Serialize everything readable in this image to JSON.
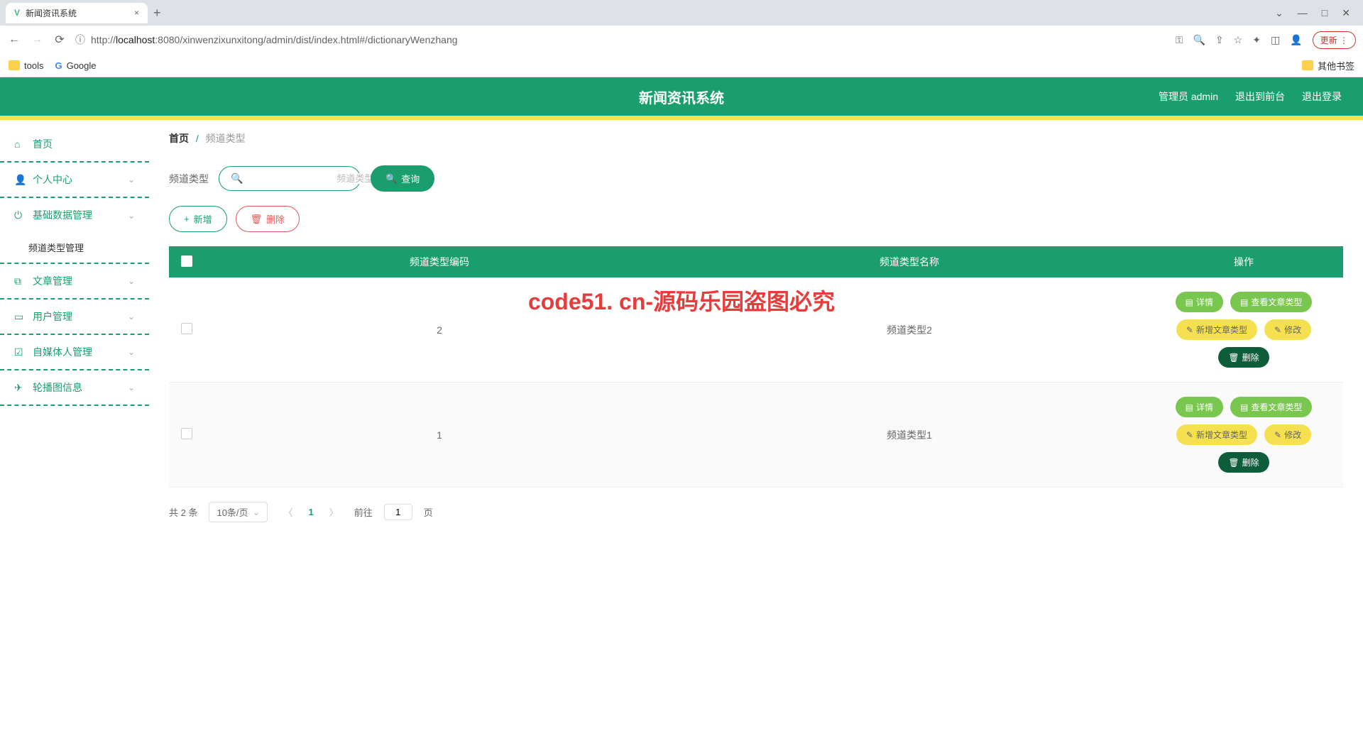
{
  "browser": {
    "tab_title": "新闻资讯系统",
    "url_info_icon": "ⓘ",
    "url_proto": "http://",
    "url_host": "localhost",
    "url_port": ":8080",
    "url_path": "/xinwenzixunxitong/admin/dist/index.html#/dictionaryWenzhang",
    "update_label": "更新",
    "bookmarks": {
      "tools": "tools",
      "google": "Google",
      "other": "其他书签"
    }
  },
  "header": {
    "title": "新闻资讯系统",
    "user": "管理员 admin",
    "to_front": "退出到前台",
    "logout": "退出登录"
  },
  "sidebar": {
    "home": "首页",
    "personal": "个人中心",
    "base_data": "基础数据管理",
    "channel_type_mgmt": "频道类型管理",
    "article": "文章管理",
    "user": "用户管理",
    "media": "自媒体人管理",
    "carousel": "轮播图信息"
  },
  "breadcrumb": {
    "home": "首页",
    "current": "频道类型"
  },
  "search": {
    "label": "频道类型",
    "placeholder": "频道类型",
    "btn": "查询"
  },
  "actions": {
    "add": "新增",
    "delete": "删除"
  },
  "table": {
    "col_code": "频道类型编码",
    "col_name": "频道类型名称",
    "col_op": "操作",
    "rows": [
      {
        "code": "2",
        "name": "频道类型2"
      },
      {
        "code": "1",
        "name": "频道类型1"
      }
    ],
    "ops": {
      "detail": "详情",
      "view_article": "查看文章类型",
      "add_article": "新增文章类型",
      "edit": "修改",
      "delete": "删除"
    }
  },
  "pager": {
    "total": "共 2 条",
    "size": "10条/页",
    "current": "1",
    "goto": "前往",
    "page_suffix": "页",
    "page_input": "1"
  },
  "watermark": "code51. cn-源码乐园盗图必究"
}
